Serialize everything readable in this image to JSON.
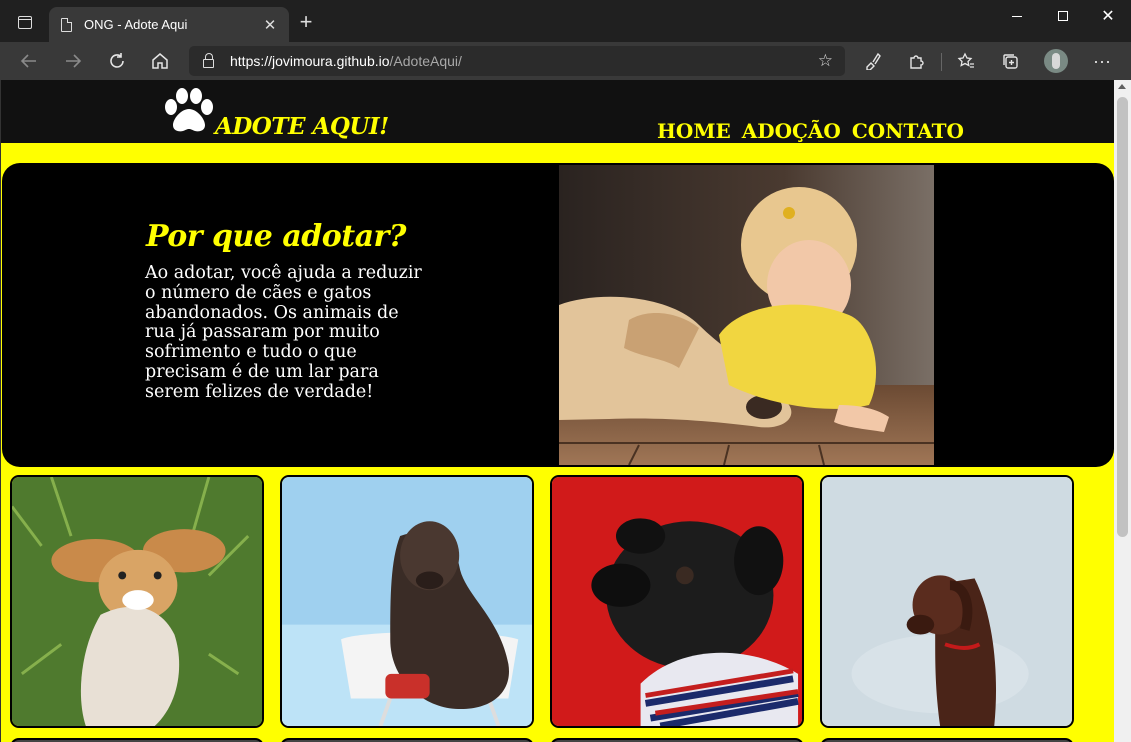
{
  "browser": {
    "tab_title": "ONG - Adote Aqui",
    "url_host": "https://jovimoura.github.io",
    "url_path": "/AdoteAqui/",
    "icons": [
      "tab-actions-icon",
      "page-icon",
      "close-icon",
      "new-tab-icon",
      "minimize-icon",
      "maximize-icon",
      "close-window-icon",
      "back-icon",
      "forward-icon",
      "refresh-icon",
      "home-icon",
      "lock-icon",
      "add-favorite-icon",
      "read-aloud-icon",
      "extensions-icon",
      "favorites-icon",
      "collections-icon",
      "profile-avatar",
      "more-icon"
    ]
  },
  "site": {
    "brand": "ADOTE AQUI!",
    "nav": [
      "HOME",
      "ADOÇÃO",
      "CONTATO"
    ],
    "hero": {
      "title": "Por que adotar?",
      "text": "Ao adotar, você ajuda a reduzir o número de cães e gatos abandonados. Os animais de rua já passaram por muito sofrimento e tudo o que precisam é de um lar para serem felizes de verdade!"
    },
    "colors": {
      "accent": "#ffff00",
      "header_bg": "#111111",
      "hero_bg": "#000000"
    }
  }
}
